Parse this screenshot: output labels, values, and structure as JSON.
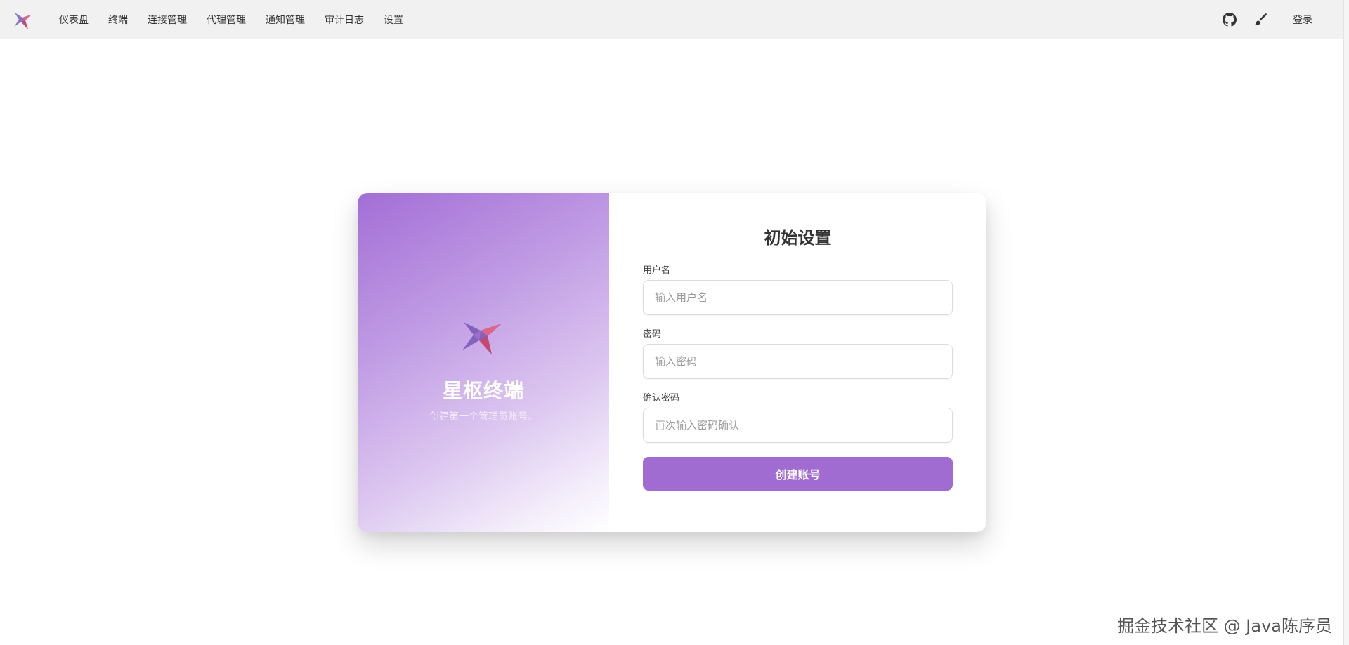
{
  "header": {
    "nav_items": [
      "仪表盘",
      "终端",
      "连接管理",
      "代理管理",
      "通知管理",
      "审计日志",
      "设置"
    ],
    "login_label": "登录",
    "icons": [
      "github-icon",
      "brush-icon"
    ]
  },
  "brand": {
    "title": "星枢终端",
    "subtitle": "创建第一个管理员账号。"
  },
  "form": {
    "title": "初始设置",
    "username_label": "用户名",
    "username_placeholder": "输入用户名",
    "password_label": "密码",
    "password_placeholder": "输入密码",
    "confirm_label": "确认密码",
    "confirm_placeholder": "再次输入密码确认",
    "submit_label": "创建账号"
  },
  "watermark": "掘金技术社区 @ Java陈序员",
  "colors": {
    "accent": "#a06cd2",
    "gradient_start": "#a36ed6",
    "topbar_bg": "#f1f1f1"
  }
}
